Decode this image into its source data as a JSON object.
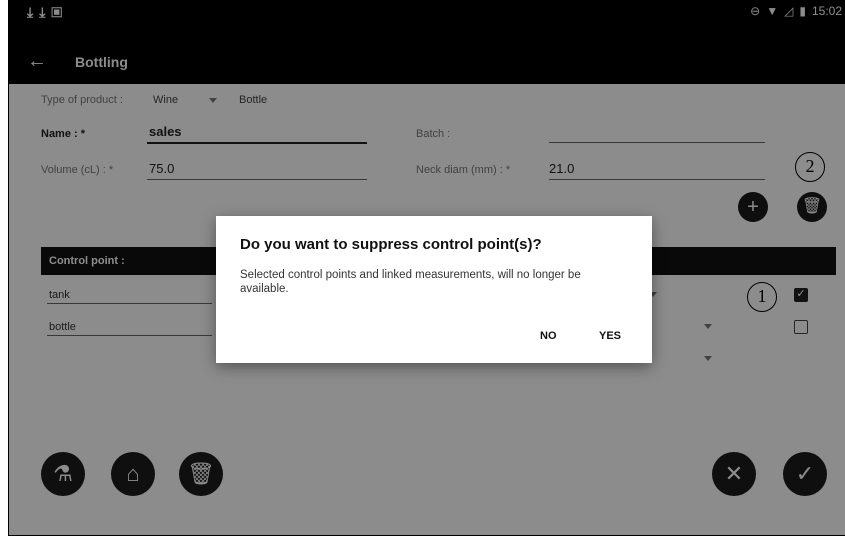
{
  "statusbar": {
    "left_icons": [
      "download-icon",
      "download-icon",
      "image-icon"
    ],
    "time": "15:02"
  },
  "appbar": {
    "back_icon": "arrow-left-icon",
    "title": "Bottling"
  },
  "form": {
    "type_label": "Type of product :",
    "type_value": "Wine",
    "type_container": "Bottle",
    "name_label": "Name : *",
    "name_value": "sales",
    "batch_label": "Batch :",
    "batch_value": "",
    "volume_label": "Volume (cL) : *",
    "volume_value": "75.0",
    "neck_label": "Neck diam (mm) : *",
    "neck_value": "21.0"
  },
  "annotations": {
    "one": "1",
    "two": "2"
  },
  "table": {
    "header": "Control point :",
    "rows": [
      {
        "name": "tank",
        "checked": true
      },
      {
        "name": "bottle",
        "checked": false
      }
    ]
  },
  "dialog": {
    "title": "Do you want to suppress control point(s)?",
    "message": "Selected control points and linked measurements, will no longer be available.",
    "no_label": "NO",
    "yes_label": "YES"
  },
  "icons": {
    "add": "plus-circle-icon",
    "delete_top": "trash-icon",
    "microscope": "microscope-icon",
    "inbox": "inbox-icon",
    "delete_bottom": "trash-icon",
    "cancel": "close-icon",
    "confirm": "check-icon"
  }
}
